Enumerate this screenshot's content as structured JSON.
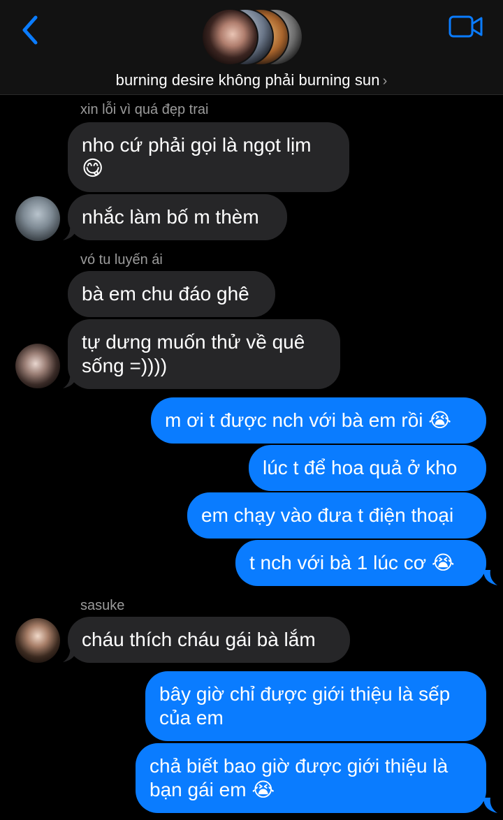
{
  "header": {
    "back_icon": "chevron-left-icon",
    "title": "burning desire không phải burning sun",
    "title_chevron": "›",
    "video_icon": "video-camera-icon",
    "accent": "#0a7cff"
  },
  "messages": [
    {
      "sender": "xin lỗi vì quá đẹp trai",
      "lines": [
        "nho cứ phải gọi là ngọt lịm",
        "😋"
      ]
    },
    {
      "lines": [
        "nhắc làm bố m thèm"
      ]
    },
    {
      "sender": "vó tu luyến ái",
      "lines": [
        "bà em chu đáo ghê"
      ]
    },
    {
      "lines": [
        "tự dưng muốn thử về quê",
        "sống =))))"
      ]
    },
    {
      "lines": [
        "m ơi t được nch với bà em rồi 😭"
      ]
    },
    {
      "lines": [
        "lúc t để hoa quả ở kho"
      ]
    },
    {
      "lines": [
        "em chạy vào đưa t điện thoại"
      ]
    },
    {
      "lines": [
        "t nch với bà 1 lúc cơ 😭"
      ]
    },
    {
      "sender": "sasuke",
      "lines": [
        "cháu thích cháu gái bà lắm"
      ]
    },
    {
      "lines": [
        "bây giờ chỉ được giới thiệu là sếp",
        "của em"
      ]
    },
    {
      "lines": [
        "chả biết bao giờ được giới thiệu là",
        "bạn gái em 😭"
      ]
    }
  ],
  "colors": {
    "incoming_bubble": "#262628",
    "outgoing_bubble": "#0a7cff",
    "background": "#000000"
  }
}
